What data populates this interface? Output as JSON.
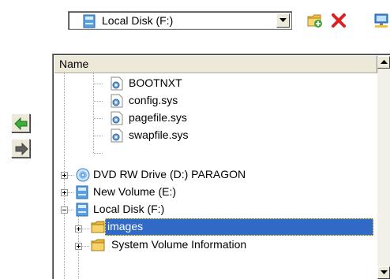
{
  "drive_combo": {
    "selected": "Local Disk (F:)",
    "icon": "drive-icon"
  },
  "toolbar": {
    "icons": [
      "new-folder-icon",
      "delete-icon",
      "network-drive-icon"
    ]
  },
  "nav": {
    "left": "arrow-left-icon",
    "right": "arrow-right-icon"
  },
  "tree": {
    "header": "Name",
    "rows": [
      {
        "label": "BOOTNXT",
        "icon": "system-file-icon"
      },
      {
        "label": "config.sys",
        "icon": "system-file-icon"
      },
      {
        "label": "pagefile.sys",
        "icon": "system-file-icon"
      },
      {
        "label": "swapfile.sys",
        "icon": "system-file-icon"
      },
      {
        "label": "DVD RW Drive (D:) PARAGON",
        "icon": "dvd-drive-icon",
        "expander": "+"
      },
      {
        "label": "New Volume (E:)",
        "icon": "drive-icon",
        "expander": "+"
      },
      {
        "label": "Local Disk (F:)",
        "icon": "drive-icon",
        "expander": "-"
      },
      {
        "label": "images",
        "icon": "folder-icon",
        "expander": "+",
        "selected": true
      },
      {
        "label": "System Volume Information",
        "icon": "folder-icon",
        "expander": "+"
      }
    ]
  },
  "colors": {
    "selection": "#3169c6",
    "selection_text": "#ffffff",
    "panel_bg": "#ece9d8"
  }
}
